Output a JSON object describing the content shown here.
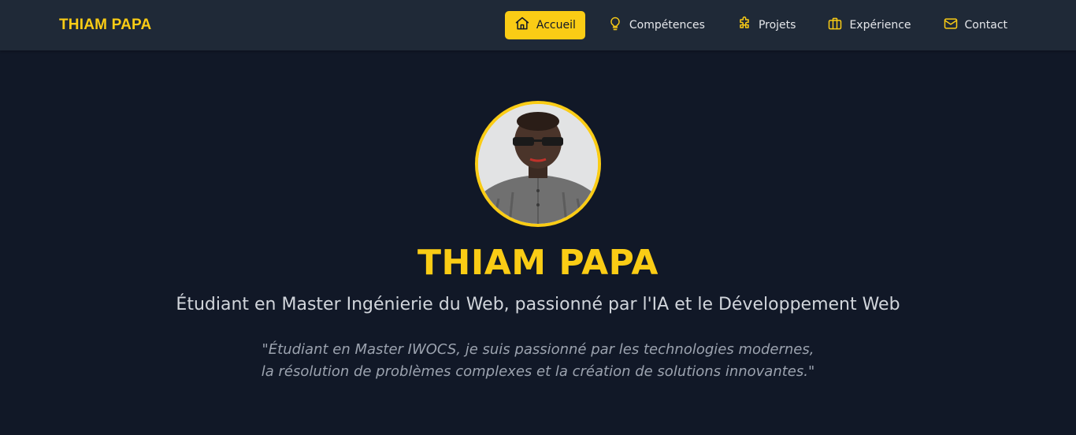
{
  "brand": "THIAM PAPA",
  "nav": {
    "items": [
      {
        "label": "Accueil",
        "icon": "home-icon",
        "active": true
      },
      {
        "label": "Compétences",
        "icon": "lightbulb-icon",
        "active": false
      },
      {
        "label": "Projets",
        "icon": "puzzle-icon",
        "active": false
      },
      {
        "label": "Expérience",
        "icon": "briefcase-icon",
        "active": false
      },
      {
        "label": "Contact",
        "icon": "mail-icon",
        "active": false
      }
    ]
  },
  "hero": {
    "name": "THIAM PAPA",
    "subtitle": "Étudiant en Master Ingénierie du Web, passionné par l'IA et le Développement Web",
    "quote_line1": "\"Étudiant en Master IWOCS, je suis passionné par les technologies modernes,",
    "quote_line2": "la résolution de problèmes complexes et la création de solutions innovantes.\""
  },
  "colors": {
    "accent": "#facc15",
    "navbar_bg": "#1f2937",
    "page_bg": "#111827"
  }
}
